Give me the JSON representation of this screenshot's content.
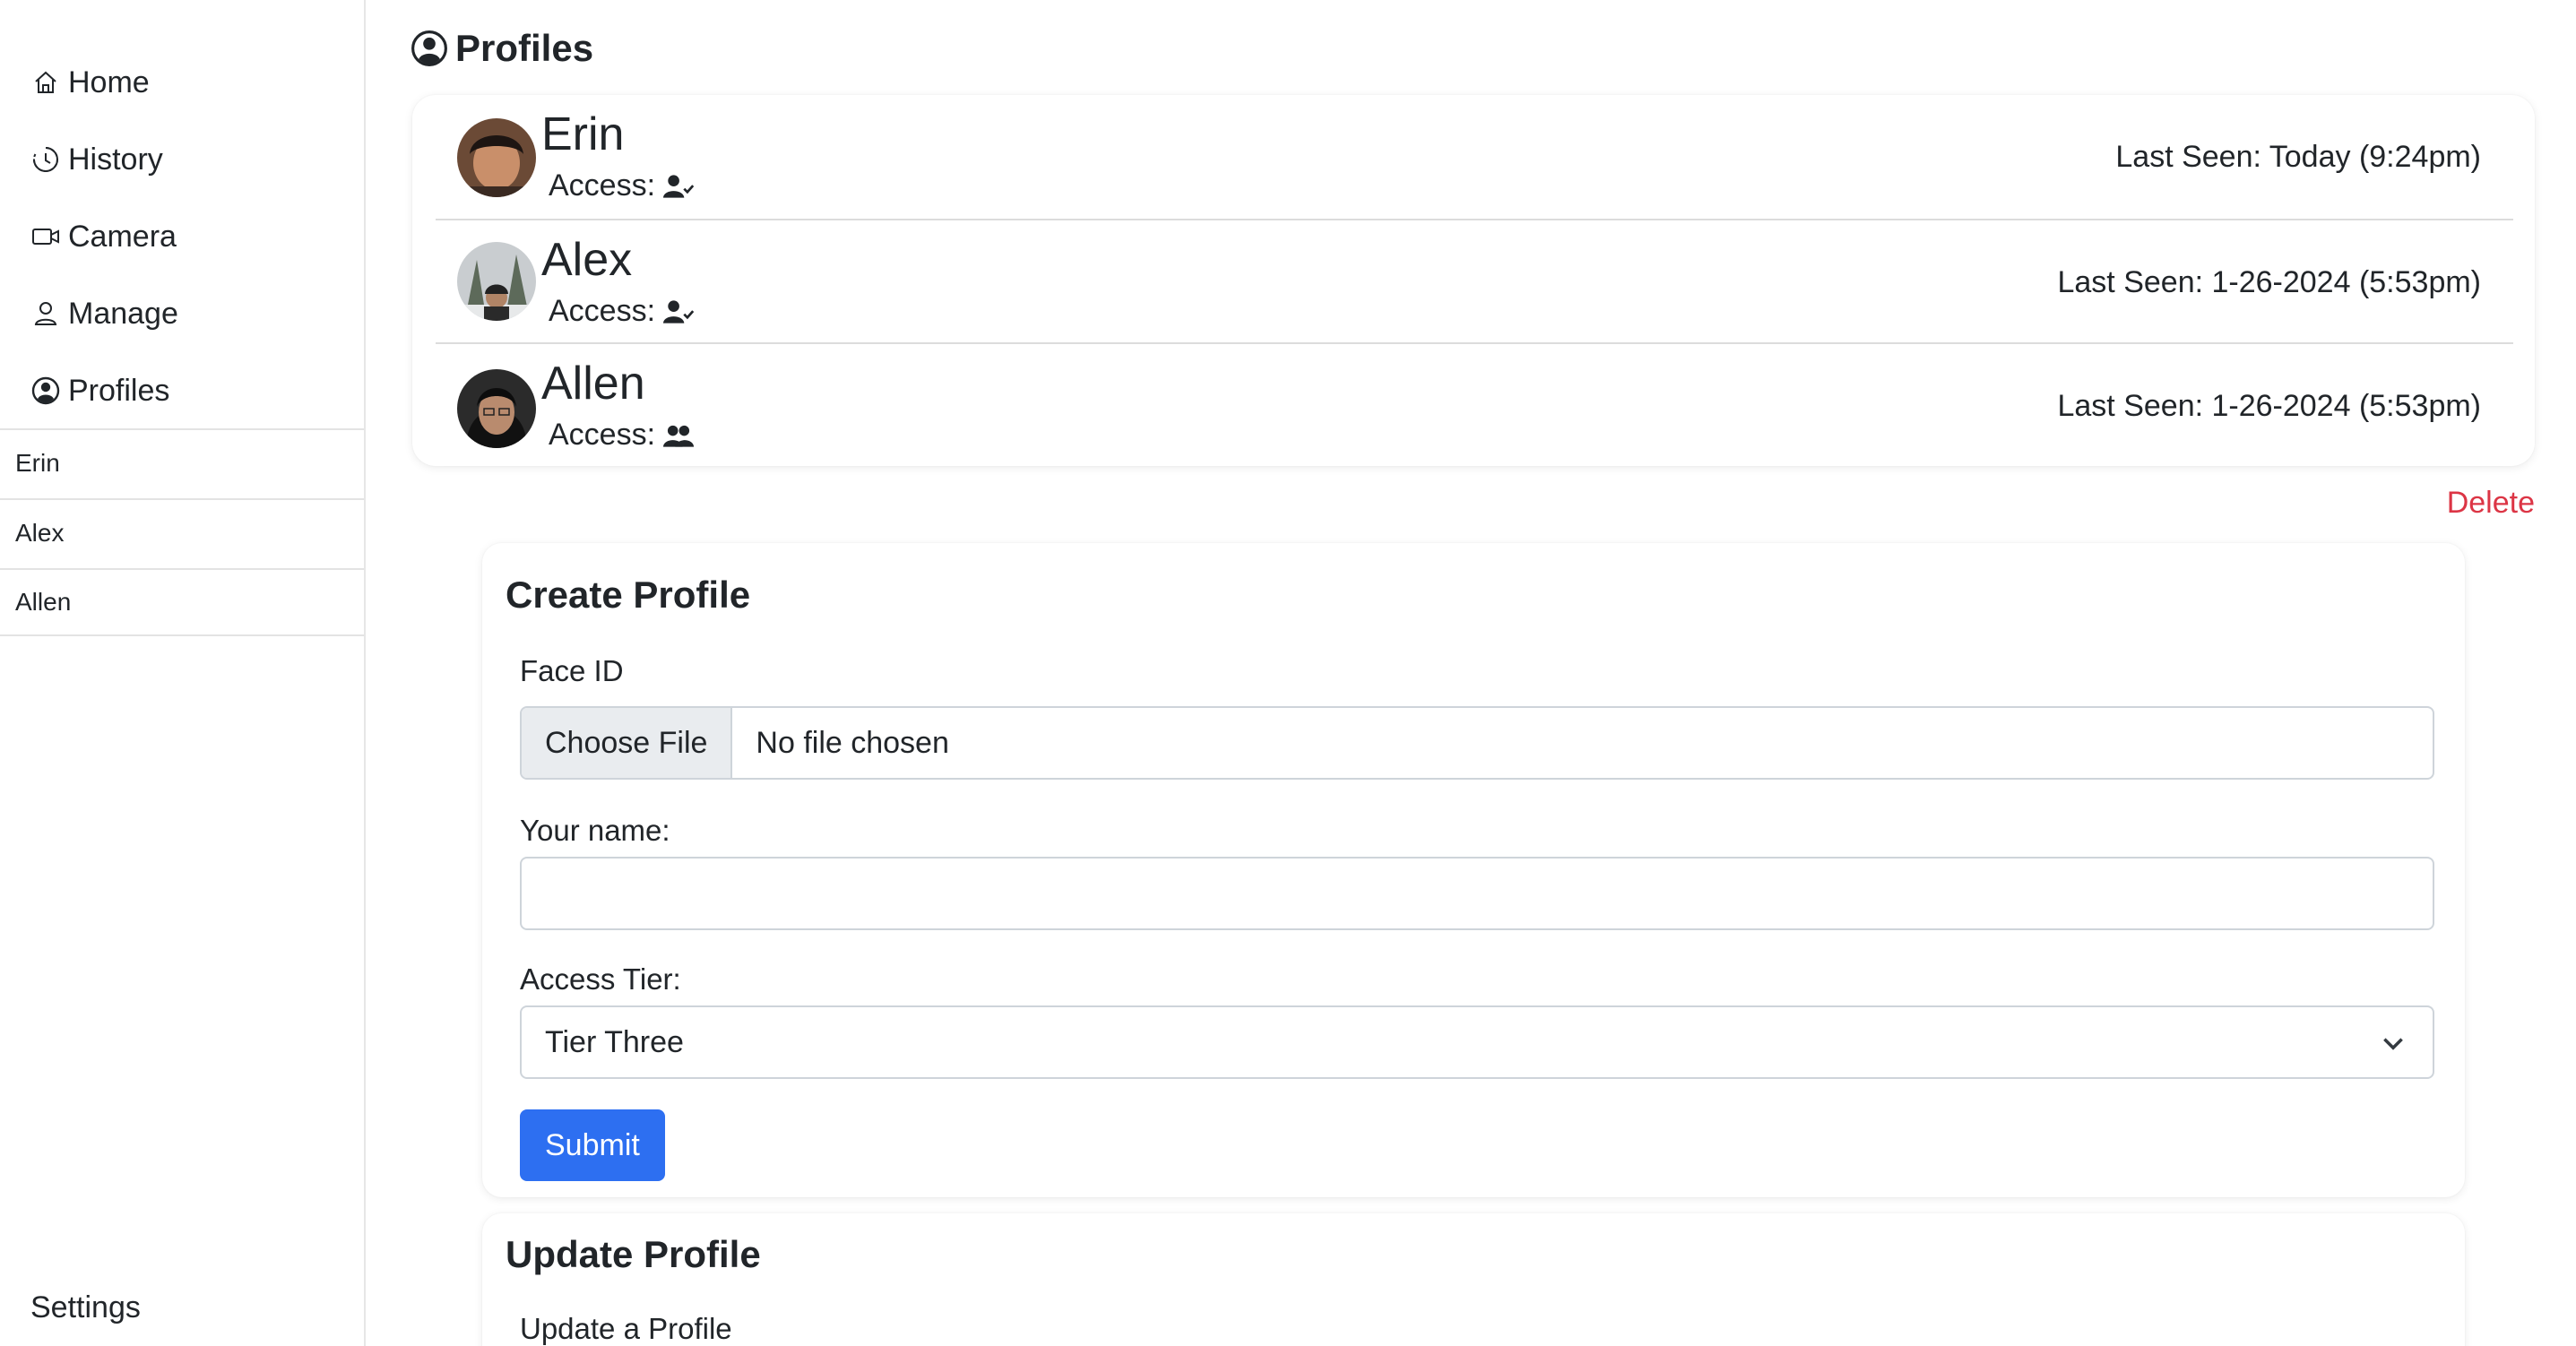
{
  "sidebar": {
    "nav": [
      {
        "label": "Home",
        "icon": "home-icon"
      },
      {
        "label": "History",
        "icon": "history-icon"
      },
      {
        "label": "Camera",
        "icon": "camera-icon"
      },
      {
        "label": "Manage",
        "icon": "person-icon"
      },
      {
        "label": "Profiles",
        "icon": "profile-circle-icon"
      }
    ],
    "profiles": [
      "Erin",
      "Alex",
      "Allen"
    ],
    "settings_label": "Settings"
  },
  "main": {
    "title": "Profiles",
    "profiles": [
      {
        "name": "Erin",
        "access_label": "Access:",
        "access_icon": "person-check-icon",
        "last_seen": "Last Seen: Today (9:24pm)"
      },
      {
        "name": "Alex",
        "access_label": "Access:",
        "access_icon": "person-check-icon",
        "last_seen": "Last Seen: 1-26-2024 (5:53pm)"
      },
      {
        "name": "Allen",
        "access_label": "Access:",
        "access_icon": "people-icon",
        "last_seen": "Last Seen: 1-26-2024 (5:53pm)"
      }
    ],
    "delete_label": "Delete",
    "create": {
      "title": "Create Profile",
      "face_id_label": "Face ID",
      "choose_file": "Choose File",
      "no_file": "No file chosen",
      "name_label": "Your name:",
      "name_value": "",
      "tier_label": "Access Tier:",
      "tier_value": "Tier Three",
      "submit": "Submit"
    },
    "update": {
      "title": "Update Profile",
      "subtitle": "Update a Profile"
    }
  },
  "colors": {
    "accent": "#2d6ff1",
    "danger": "#dc3545",
    "border": "#ced4da"
  }
}
